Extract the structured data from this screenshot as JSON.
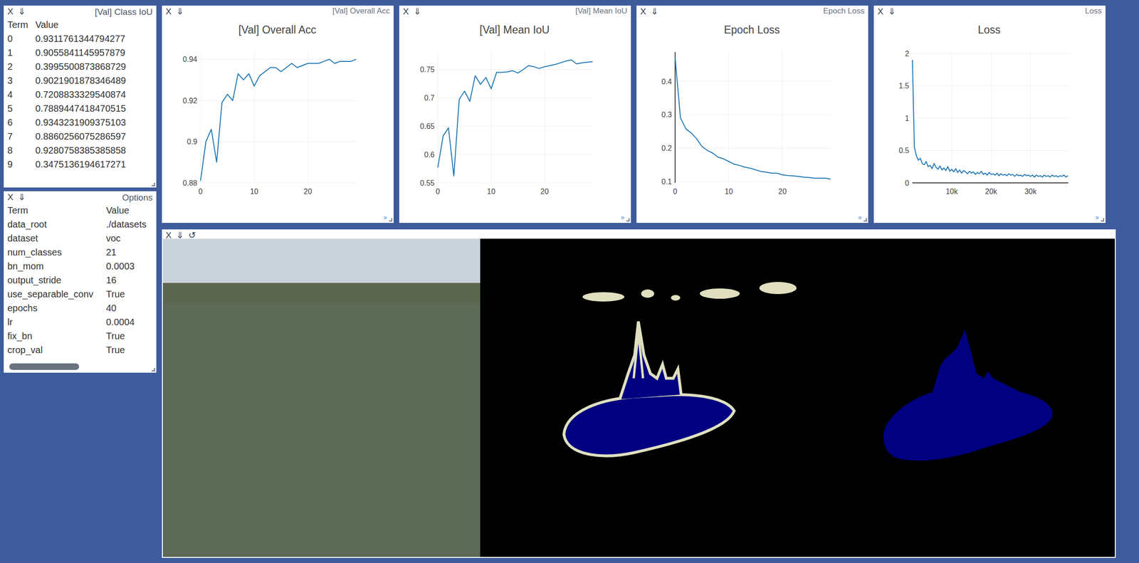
{
  "panel_controls": {
    "close": "X",
    "download": "⇓",
    "refresh": "↺",
    "expand": "»"
  },
  "class_iou": {
    "title": "[Val] Class IoU",
    "columns": [
      "Term",
      "Value"
    ],
    "rows": [
      {
        "term": "0",
        "value": "0.9311761344794277"
      },
      {
        "term": "1",
        "value": "0.9055841145957879"
      },
      {
        "term": "2",
        "value": "0.3995500873868729"
      },
      {
        "term": "3",
        "value": "0.9021901878346489"
      },
      {
        "term": "4",
        "value": "0.7208833329540874"
      },
      {
        "term": "5",
        "value": "0.7889447418470515"
      },
      {
        "term": "6",
        "value": "0.9343231909375103"
      },
      {
        "term": "7",
        "value": "0.8860256075286597"
      },
      {
        "term": "8",
        "value": "0.9280758385385858"
      },
      {
        "term": "9",
        "value": "0.3475136194617271"
      }
    ]
  },
  "options": {
    "title": "Options",
    "columns": [
      "Term",
      "Value"
    ],
    "rows": [
      {
        "term": "data_root",
        "value": "./datasets"
      },
      {
        "term": "dataset",
        "value": "voc"
      },
      {
        "term": "num_classes",
        "value": "21"
      },
      {
        "term": "bn_mom",
        "value": "0.0003"
      },
      {
        "term": "output_stride",
        "value": "16"
      },
      {
        "term": "use_separable_conv",
        "value": "True"
      },
      {
        "term": "epochs",
        "value": "40"
      },
      {
        "term": "lr",
        "value": "0.0004"
      },
      {
        "term": "fix_bn",
        "value": "True"
      },
      {
        "term": "crop_val",
        "value": "True"
      }
    ]
  },
  "charts": [
    {
      "header_title": "[Val] Overall Acc",
      "title": "[Val] Overall Acc",
      "x_step": 1,
      "x_range": [
        0,
        29.05
      ],
      "y_range": [
        0.88,
        0.9435
      ],
      "zero_x": false,
      "zero_y": false,
      "x_ticks": [
        {
          "label": "0",
          "value": 0
        },
        {
          "label": "10",
          "value": 10
        },
        {
          "label": "20",
          "value": 20
        }
      ],
      "y_ticks": [
        {
          "label": "0.88",
          "value": 0.88
        },
        {
          "label": "0.9",
          "value": 0.9
        },
        {
          "label": "0.92",
          "value": 0.92
        },
        {
          "label": "0.94",
          "value": 0.94
        }
      ],
      "values": [
        0.881,
        0.9,
        0.906,
        0.89,
        0.919,
        0.923,
        0.92,
        0.933,
        0.93,
        0.933,
        0.927,
        0.932,
        0.934,
        0.936,
        0.936,
        0.934,
        0.936,
        0.938,
        0.936,
        0.937,
        0.938,
        0.938,
        0.938,
        0.939,
        0.94,
        0.938,
        0.939,
        0.939,
        0.939,
        0.94
      ]
    },
    {
      "header_title": "[Val] Mean IoU",
      "title": "[Val] Mean IoU",
      "x_step": 1,
      "x_range": [
        0,
        29.2
      ],
      "y_range": [
        0.55,
        0.7808
      ],
      "zero_x": false,
      "zero_y": false,
      "x_ticks": [
        {
          "label": "0",
          "value": 0
        },
        {
          "label": "10",
          "value": 10
        },
        {
          "label": "20",
          "value": 20
        }
      ],
      "y_ticks": [
        {
          "label": "0.55",
          "value": 0.55
        },
        {
          "label": "0.6",
          "value": 0.6
        },
        {
          "label": "0.65",
          "value": 0.65
        },
        {
          "label": "0.7",
          "value": 0.7
        },
        {
          "label": "0.75",
          "value": 0.75
        }
      ],
      "values": [
        0.577,
        0.633,
        0.647,
        0.562,
        0.697,
        0.712,
        0.694,
        0.739,
        0.724,
        0.736,
        0.716,
        0.745,
        0.745,
        0.746,
        0.748,
        0.744,
        0.75,
        0.757,
        0.755,
        0.752,
        0.755,
        0.757,
        0.759,
        0.762,
        0.765,
        0.767,
        0.76,
        0.762,
        0.763,
        0.764
      ]
    },
    {
      "header_title": "Epoch Loss",
      "title": "Epoch Loss",
      "x_step": 1,
      "x_range": [
        0,
        29.05
      ],
      "y_range": [
        0.096,
        0.487
      ],
      "zero_x": true,
      "zero_y": false,
      "x_ticks": [
        {
          "label": "0",
          "value": 0
        },
        {
          "label": "10",
          "value": 10
        },
        {
          "label": "20",
          "value": 20
        }
      ],
      "y_ticks": [
        {
          "label": "0.1",
          "value": 0.1
        },
        {
          "label": "0.2",
          "value": 0.2
        },
        {
          "label": "0.3",
          "value": 0.3
        },
        {
          "label": "0.4",
          "value": 0.4
        }
      ],
      "values": [
        0.47,
        0.29,
        0.258,
        0.245,
        0.228,
        0.205,
        0.193,
        0.185,
        0.173,
        0.168,
        0.16,
        0.152,
        0.148,
        0.143,
        0.14,
        0.135,
        0.13,
        0.128,
        0.125,
        0.125,
        0.12,
        0.118,
        0.117,
        0.115,
        0.113,
        0.112,
        0.11,
        0.11,
        0.11,
        0.107
      ]
    },
    {
      "header_title": "Loss",
      "title": "Loss",
      "x_step": 500,
      "x_range": [
        0,
        39600
      ],
      "y_range": [
        0,
        2.02
      ],
      "zero_x": false,
      "zero_y": true,
      "x_ticks": [
        {
          "label": "10k",
          "value": 10000
        },
        {
          "label": "20k",
          "value": 20000
        },
        {
          "label": "30k",
          "value": 30000
        }
      ],
      "y_ticks": [
        {
          "label": "0",
          "value": 0
        },
        {
          "label": "0.5",
          "value": 0.5
        },
        {
          "label": "1",
          "value": 1
        },
        {
          "label": "1.5",
          "value": 1.5
        },
        {
          "label": "2",
          "value": 2
        }
      ],
      "values": [
        1.9,
        0.55,
        0.42,
        0.35,
        0.38,
        0.3,
        0.28,
        0.33,
        0.25,
        0.27,
        0.22,
        0.3,
        0.24,
        0.21,
        0.26,
        0.2,
        0.23,
        0.19,
        0.25,
        0.18,
        0.21,
        0.17,
        0.22,
        0.16,
        0.2,
        0.15,
        0.19,
        0.17,
        0.14,
        0.18,
        0.15,
        0.17,
        0.13,
        0.16,
        0.14,
        0.18,
        0.13,
        0.15,
        0.12,
        0.16,
        0.13,
        0.14,
        0.12,
        0.15,
        0.11,
        0.14,
        0.12,
        0.13,
        0.11,
        0.14,
        0.12,
        0.13,
        0.1,
        0.13,
        0.11,
        0.12,
        0.1,
        0.13,
        0.11,
        0.12,
        0.1,
        0.12,
        0.09,
        0.12,
        0.1,
        0.11,
        0.09,
        0.12,
        0.1,
        0.11,
        0.09,
        0.12,
        0.1,
        0.11,
        0.09,
        0.11,
        0.1,
        0.12,
        0.09,
        0.11
      ]
    }
  ],
  "images": {
    "panels": [
      "input",
      "prediction",
      "ground_truth"
    ]
  }
}
